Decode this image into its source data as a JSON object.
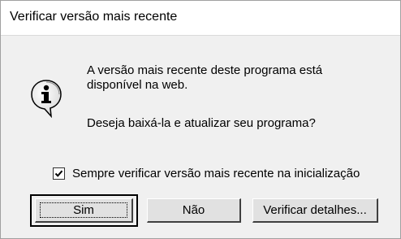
{
  "dialog": {
    "title": "Verificar versão mais recente",
    "icon": "info-icon",
    "message_line1": "A versão mais recente deste programa está",
    "message_line2": "disponível na web.",
    "message_line3": "Deseja baixá-la e atualizar seu programa?",
    "checkbox": {
      "label": "Sempre verificar versão mais recente na inicialização",
      "checked": true
    },
    "buttons": {
      "yes": "Sim",
      "no": "Não",
      "details": "Verificar detalhes..."
    }
  }
}
